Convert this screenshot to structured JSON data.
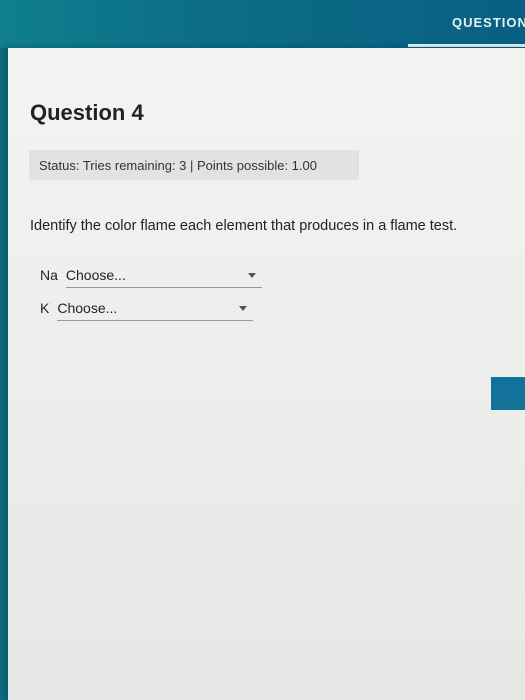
{
  "header": {
    "tab_label": "QUESTION"
  },
  "question": {
    "title": "Question 4",
    "status": "Status: Tries remaining: 3 | Points possible: 1.00",
    "prompt": "Identify the color flame each element that produces in a flame test.",
    "items": [
      {
        "label": "Na",
        "selected": "Choose..."
      },
      {
        "label": "K",
        "selected": "Choose..."
      }
    ]
  },
  "colors": {
    "header_teal": "#0b6d86",
    "panel_bg": "#f0f0ee",
    "status_bg": "#e2e2e0",
    "side_button": "#13729a"
  },
  "icons": {
    "dropdown": "caret-down-icon"
  }
}
